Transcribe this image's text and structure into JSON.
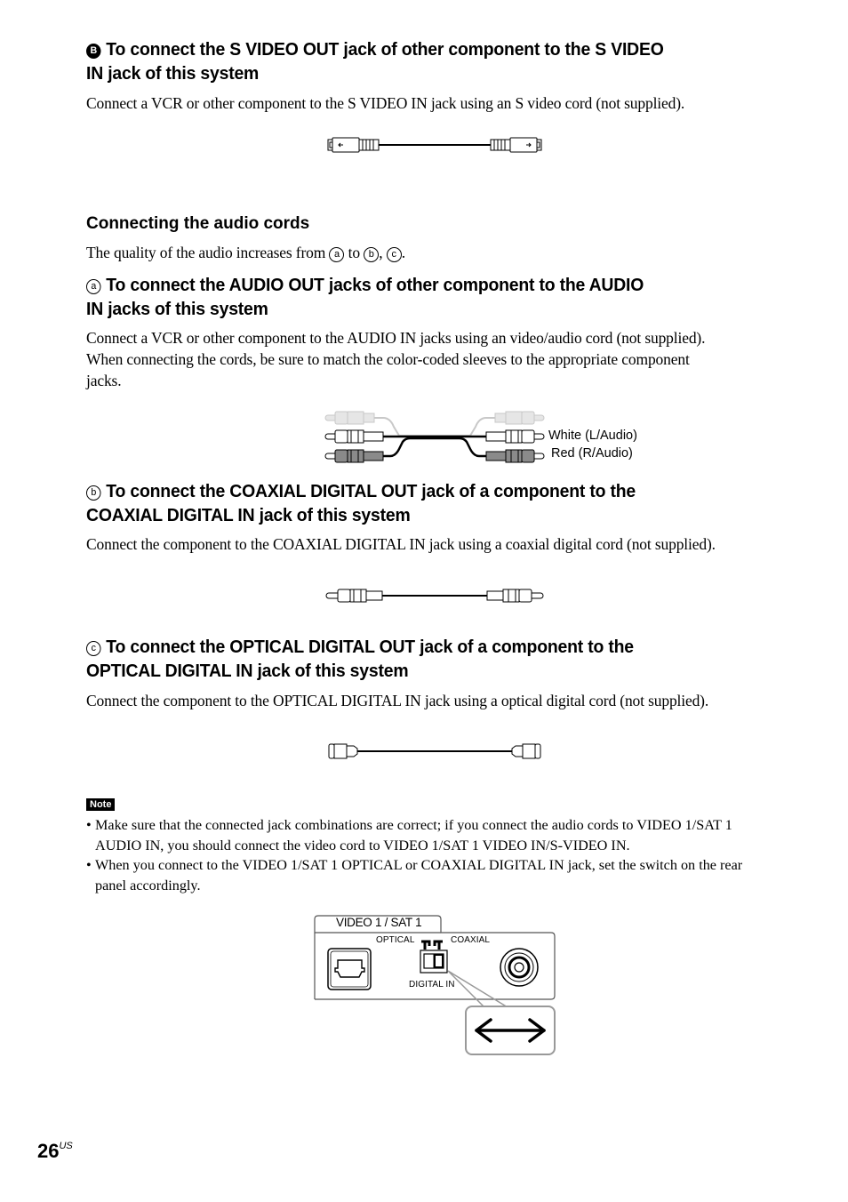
{
  "section_b_svideo": {
    "marker": "B",
    "heading_line1": "To connect the S VIDEO OUT jack of other component to the S VIDEO",
    "heading_line2": "IN jack of this system",
    "body": "Connect a VCR or other component to the S VIDEO IN jack using an S video cord (not supplied).",
    "illustration": "s-video-cord"
  },
  "audio_cords": {
    "heading": "Connecting the audio cords",
    "quality_text_prefix": "The quality of the audio increases from",
    "quality_marker_a": "a",
    "quality_to": "to",
    "quality_marker_b": "b",
    "quality_comma": ",",
    "quality_marker_c": "c",
    "quality_period": "."
  },
  "section_a_audio": {
    "marker": "a",
    "heading_line1": "To connect the AUDIO OUT jacks of other component to the AUDIO",
    "heading_line2": "IN jacks of this system",
    "body_line1": "Connect a VCR or other component to the AUDIO IN jacks using an video/audio cord (not supplied).",
    "body_line2": "When connecting the cords, be sure to match the color-coded sleeves to the appropriate component",
    "body_line3": "jacks.",
    "label_white": "White (L/Audio)",
    "label_red": "Red (R/Audio)",
    "illustration": "audio-video-cord"
  },
  "section_b_coaxial": {
    "marker": "b",
    "heading_line1": "To connect the COAXIAL DIGITAL OUT jack of a component to the",
    "heading_line2": "COAXIAL DIGITAL IN jack of this system",
    "body": "Connect the component to the COAXIAL DIGITAL IN jack using a coaxial digital cord (not supplied).",
    "illustration": "coaxial-digital-cord"
  },
  "section_c_optical": {
    "marker": "c",
    "heading_line1": "To connect the OPTICAL DIGITAL OUT jack of a component to the",
    "heading_line2": "OPTICAL DIGITAL IN jack of this system",
    "body": "Connect the component to the OPTICAL DIGITAL IN jack using a optical digital cord (not supplied).",
    "illustration": "optical-digital-cord"
  },
  "note": {
    "badge": "Note",
    "items": [
      {
        "line1": "Make sure that the connected jack combinations are correct; if you connect the audio cords to VIDEO 1/SAT 1",
        "line2": "AUDIO IN, you should connect the video cord to VIDEO 1/SAT 1 VIDEO IN/S-VIDEO IN."
      },
      {
        "line1": "When you connect to the VIDEO 1/SAT 1 OPTICAL or COAXIAL DIGITAL IN jack, set the switch on the rear",
        "line2": "panel accordingly."
      }
    ]
  },
  "rear_panel": {
    "title": "VIDEO 1 / SAT 1",
    "optical_label": "OPTICAL",
    "coaxial_label": "COAXIAL",
    "digital_in_label": "DIGITAL IN",
    "switch_position": "COAXIAL"
  },
  "footer": {
    "page_number": "26",
    "page_suffix": "US"
  }
}
